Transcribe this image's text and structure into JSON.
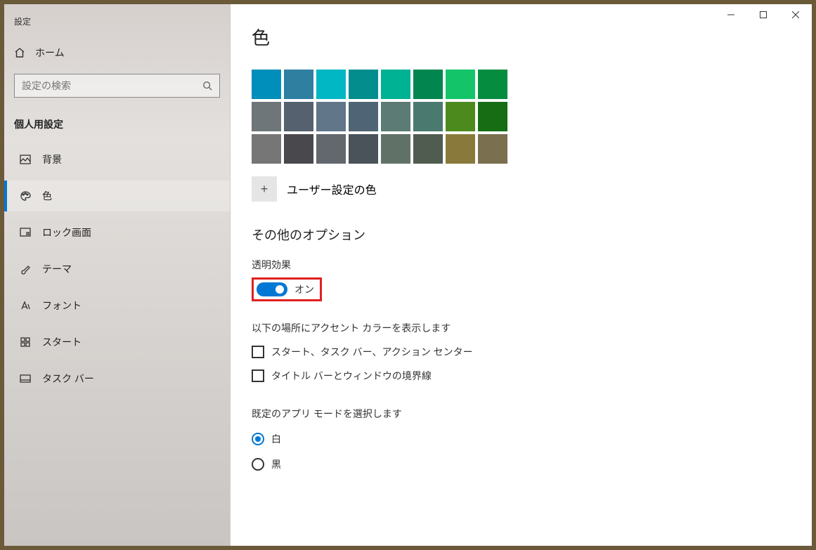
{
  "app_title": "設定",
  "home_label": "ホーム",
  "search": {
    "placeholder": "設定の検索"
  },
  "section_label": "個人用設定",
  "nav": [
    {
      "id": "background",
      "label": "背景"
    },
    {
      "id": "colors",
      "label": "色"
    },
    {
      "id": "lockscreen",
      "label": "ロック画面"
    },
    {
      "id": "themes",
      "label": "テーマ"
    },
    {
      "id": "fonts",
      "label": "フォント"
    },
    {
      "id": "start",
      "label": "スタート"
    },
    {
      "id": "taskbar",
      "label": "タスク バー"
    }
  ],
  "page": {
    "title": "色",
    "swatch_rows": [
      [
        "#008fba",
        "#2e7fa0",
        "#00b7c3",
        "#038d8d",
        "#00b294",
        "#03854f",
        "#13c469",
        "#068c3f"
      ],
      [
        "#6f7679",
        "#55616e",
        "#62768a",
        "#4f6575",
        "#5b7b74",
        "#4a7a6f",
        "#4c8a1e",
        "#166d14"
      ],
      [
        "#767676",
        "#49494d",
        "#62686d",
        "#4a5359",
        "#607268",
        "#505c50",
        "#897a3b",
        "#7a6f4e"
      ]
    ],
    "custom_color_label": "ユーザー設定の色",
    "other_options_label": "その他のオプション",
    "transparency": {
      "label": "透明効果",
      "state_label": "オン"
    },
    "accent": {
      "heading": "以下の場所にアクセント カラーを表示します",
      "checks": [
        {
          "label": "スタート、タスク バー、アクション センター",
          "checked": false
        },
        {
          "label": "タイトル バーとウィンドウの境界線",
          "checked": false
        }
      ]
    },
    "appmode": {
      "heading": "既定のアプリ モードを選択します",
      "options": [
        {
          "label": "白",
          "selected": true
        },
        {
          "label": "黒",
          "selected": false
        }
      ]
    }
  }
}
